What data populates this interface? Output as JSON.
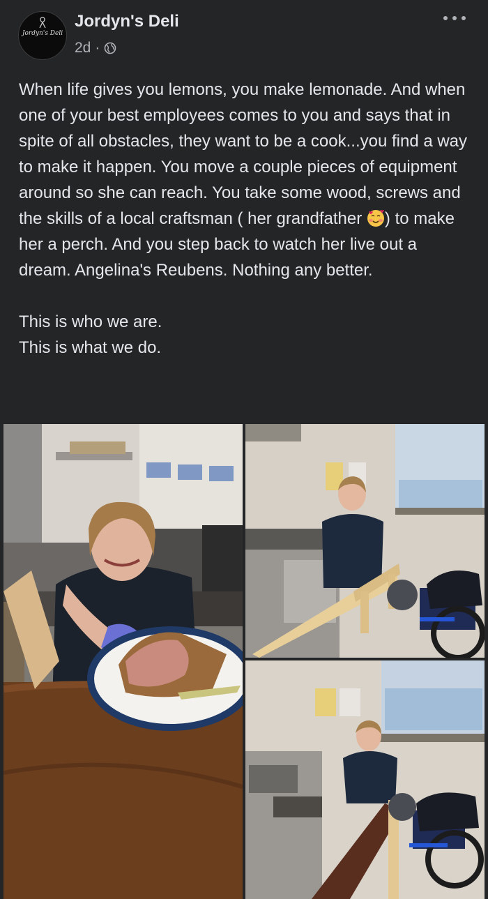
{
  "post": {
    "page_name": "Jordyn's Deli",
    "avatar_logo_text": "Jordyn's Deli",
    "time": "2d",
    "separator": "·",
    "audience_icon": "globe-icon",
    "more_icon": "more-horizontal-icon",
    "text_part1": "When life gives you lemons, you make lemonade. And when one of your best employees comes to you and says that in spite of all obstacles, they want to be a cook...you find a way to make it happen. You move a couple pieces of equipment around so she can reach. You take some wood, screws and the skills of a local craftsman ( her grandfather",
    "text_emoji": "smiling-face-with-hearts-emoji",
    "text_part2": ") to make her a perch. And you step back to watch her live out a dream. Angelina's Reubens. Nothing any better.",
    "text_closing": "This is who we are.\nThis is what we do."
  },
  "colors": {
    "background": "#242526",
    "primary_text": "#e4e6eb",
    "secondary_text": "#b0b3b8"
  },
  "photos": [
    {
      "id": "photo-1",
      "content": "girl-holding-reuben-sandwich-plate"
    },
    {
      "id": "photo-2",
      "content": "girl-in-kitchen-with-wooden-perch-and-wheelchair"
    },
    {
      "id": "photo-3",
      "content": "girl-leaning-on-padded-perch-with-wheelchair"
    }
  ]
}
